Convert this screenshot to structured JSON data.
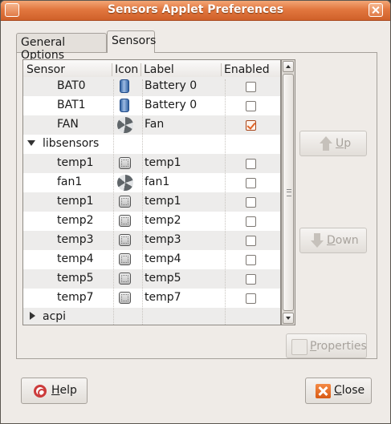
{
  "window": {
    "title": "Sensors Applet Preferences"
  },
  "tabs": [
    {
      "label": "General Options",
      "active": false
    },
    {
      "label": "Sensors",
      "active": true
    }
  ],
  "tree": {
    "columns": {
      "sensor": "Sensor",
      "icon": "Icon",
      "label": "Label",
      "enabled": "Enabled"
    },
    "rows": [
      {
        "sensor": "BAT0",
        "icon": "battery-icon",
        "label": "Battery 0",
        "enabled": false
      },
      {
        "sensor": "BAT1",
        "icon": "battery-icon",
        "label": "Battery 0",
        "enabled": false
      },
      {
        "sensor": "FAN",
        "icon": "fan-icon",
        "label": "Fan",
        "enabled": true
      },
      {
        "group": "libsensors",
        "expanded": true
      },
      {
        "sensor": "temp1",
        "icon": "chip-icon",
        "label": "temp1",
        "enabled": false
      },
      {
        "sensor": "fan1",
        "icon": "fan-icon",
        "label": "fan1",
        "enabled": false
      },
      {
        "sensor": "temp1",
        "icon": "chip-icon",
        "label": "temp1",
        "enabled": false
      },
      {
        "sensor": "temp2",
        "icon": "chip-icon",
        "label": "temp2",
        "enabled": false
      },
      {
        "sensor": "temp3",
        "icon": "chip-icon",
        "label": "temp3",
        "enabled": false
      },
      {
        "sensor": "temp4",
        "icon": "chip-icon",
        "label": "temp4",
        "enabled": false
      },
      {
        "sensor": "temp5",
        "icon": "chip-icon",
        "label": "temp5",
        "enabled": false
      },
      {
        "sensor": "temp7",
        "icon": "chip-icon",
        "label": "temp7",
        "enabled": false
      },
      {
        "group": "acpi",
        "expanded": false
      }
    ]
  },
  "buttons": {
    "up": {
      "mnemonic": "U",
      "rest": "p",
      "enabled": false
    },
    "down": {
      "mnemonic": "D",
      "rest": "own",
      "enabled": false
    },
    "properties": {
      "mnemonic": "P",
      "rest": "roperties",
      "enabled": false
    },
    "help": {
      "mnemonic": "H",
      "rest": "elp"
    },
    "close": {
      "mnemonic": "C",
      "rest": "lose"
    }
  },
  "colors": {
    "accent": "#e06225",
    "titlebar": "#e2773f",
    "row_alt": "#edeceb"
  }
}
